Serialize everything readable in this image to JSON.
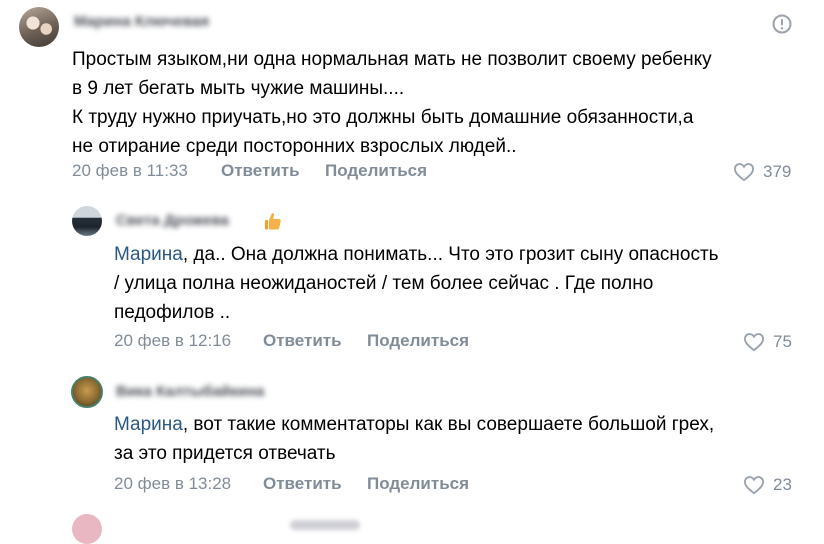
{
  "comments": [
    {
      "author": "Марина Ключевая",
      "lines": [
        "Простым языком,ни одна нормальная мать не позволит своему ребенку",
        "в 9 лет бегать мыть чужие машины....",
        "К труду нужно приучать,но это должны быть домашние обязанности,а",
        "не отирание среди посторонних взрослых людей.."
      ],
      "date": "20 фев в 11:33",
      "reply_label": "Ответить",
      "share_label": "Поделиться",
      "likes": "379"
    },
    {
      "author": "Света Дрожева",
      "mention": "Марина",
      "lines": [
        ", да.. Она должна понимать... Что это грозит сыну опасность",
        "/ улица полна неожиданостей / тем более сейчас . Где полно",
        "педофилов .."
      ],
      "date": "20 фев в 12:16",
      "reply_label": "Ответить",
      "share_label": "Поделиться",
      "likes": "75"
    },
    {
      "author": "Вика Калтыбайкина",
      "mention": "Марина",
      "lines": [
        ", вот такие комментаторы как вы совершаете большой грех,",
        "за это придется отвечать"
      ],
      "date": "20 фев в 13:28",
      "reply_label": "Ответить",
      "share_label": "Поделиться",
      "likes": "23"
    }
  ],
  "colors": {
    "meta": "#818c99",
    "mention": "#2a5885",
    "text": "#000000"
  },
  "icons": [
    "report-icon",
    "heart-icon",
    "thumbs-up-emoji"
  ]
}
